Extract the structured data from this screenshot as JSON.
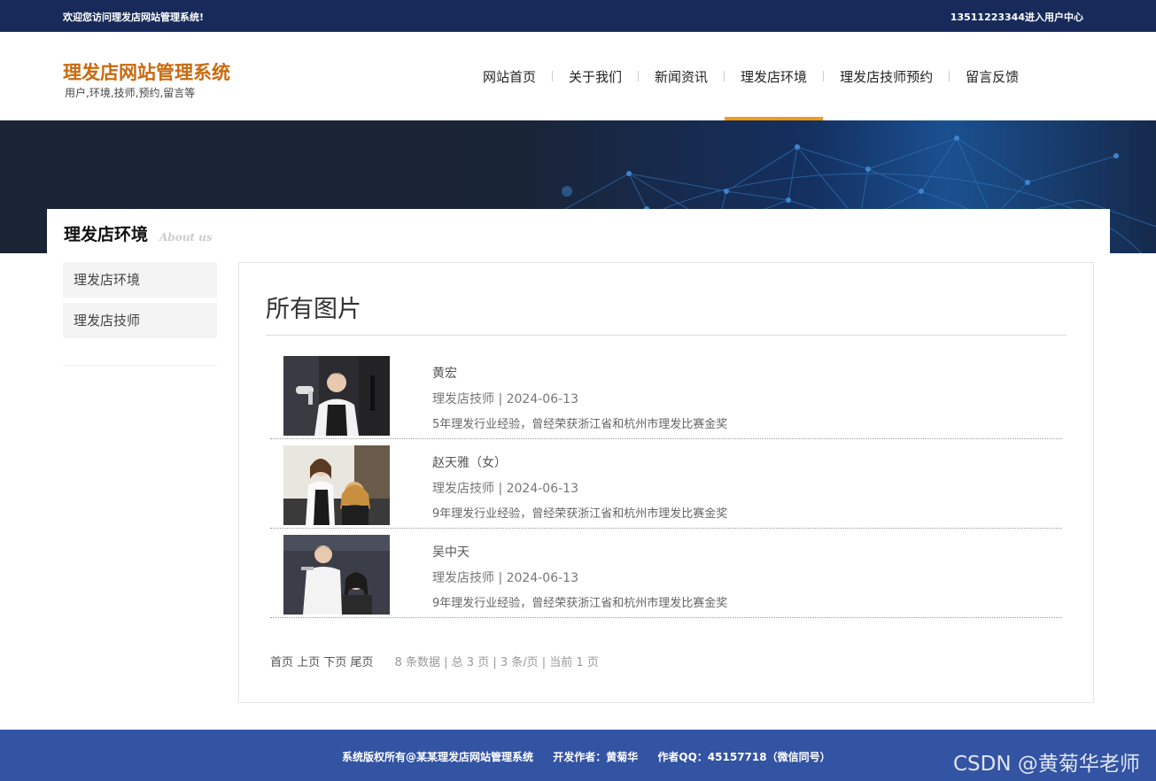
{
  "topbar": {
    "welcome": "欢迎您访问理发店网站管理系统!",
    "user_center": "13511223344进入用户中心"
  },
  "logo": {
    "title": "理发店网站管理系统",
    "subtitle": "用户,环境,技师,预约,留言等"
  },
  "nav": [
    {
      "label": "网站首页",
      "active": false
    },
    {
      "label": "关于我们",
      "active": false
    },
    {
      "label": "新闻资讯",
      "active": false
    },
    {
      "label": "理发店环境",
      "active": true
    },
    {
      "label": "理发店技师预约",
      "active": false
    },
    {
      "label": "留言反馈",
      "active": false
    }
  ],
  "section": {
    "title": "理发店环境",
    "subtitle_en": "About us"
  },
  "sidebar": {
    "items": [
      {
        "label": "理发店环境"
      },
      {
        "label": "理发店技师"
      }
    ]
  },
  "content": {
    "heading": "所有图片",
    "items": [
      {
        "name": "黄宏",
        "meta": "理发店技师 | 2024-06-13",
        "desc": "5年理发行业经验，曾经荣获浙江省和杭州市理发比赛金奖"
      },
      {
        "name": "赵天雅（女）",
        "meta": "理发店技师 | 2024-06-13",
        "desc": "9年理发行业经验，曾经荣获浙江省和杭州市理发比赛金奖"
      },
      {
        "name": "吴中天",
        "meta": "理发店技师 | 2024-06-13",
        "desc": "9年理发行业经验，曾经荣获浙江省和杭州市理发比赛金奖"
      }
    ],
    "pager": {
      "first": "首页",
      "prev": "上页",
      "next": "下页",
      "last": "尾页",
      "info": "8 条数据 | 总 3 页 | 3 条/页 | 当前 1 页"
    }
  },
  "footer": {
    "copyright": "系统版权所有@某某理发店网站管理系统",
    "author": "开发作者：黄菊华",
    "qq": "作者QQ：45157718（微信同号）"
  },
  "watermark": "CSDN @黄菊华老师",
  "colors": {
    "topbar": "#172a5a",
    "brand": "#c96a10",
    "nav_active": "#f09a16",
    "footer": "#3353a3"
  }
}
